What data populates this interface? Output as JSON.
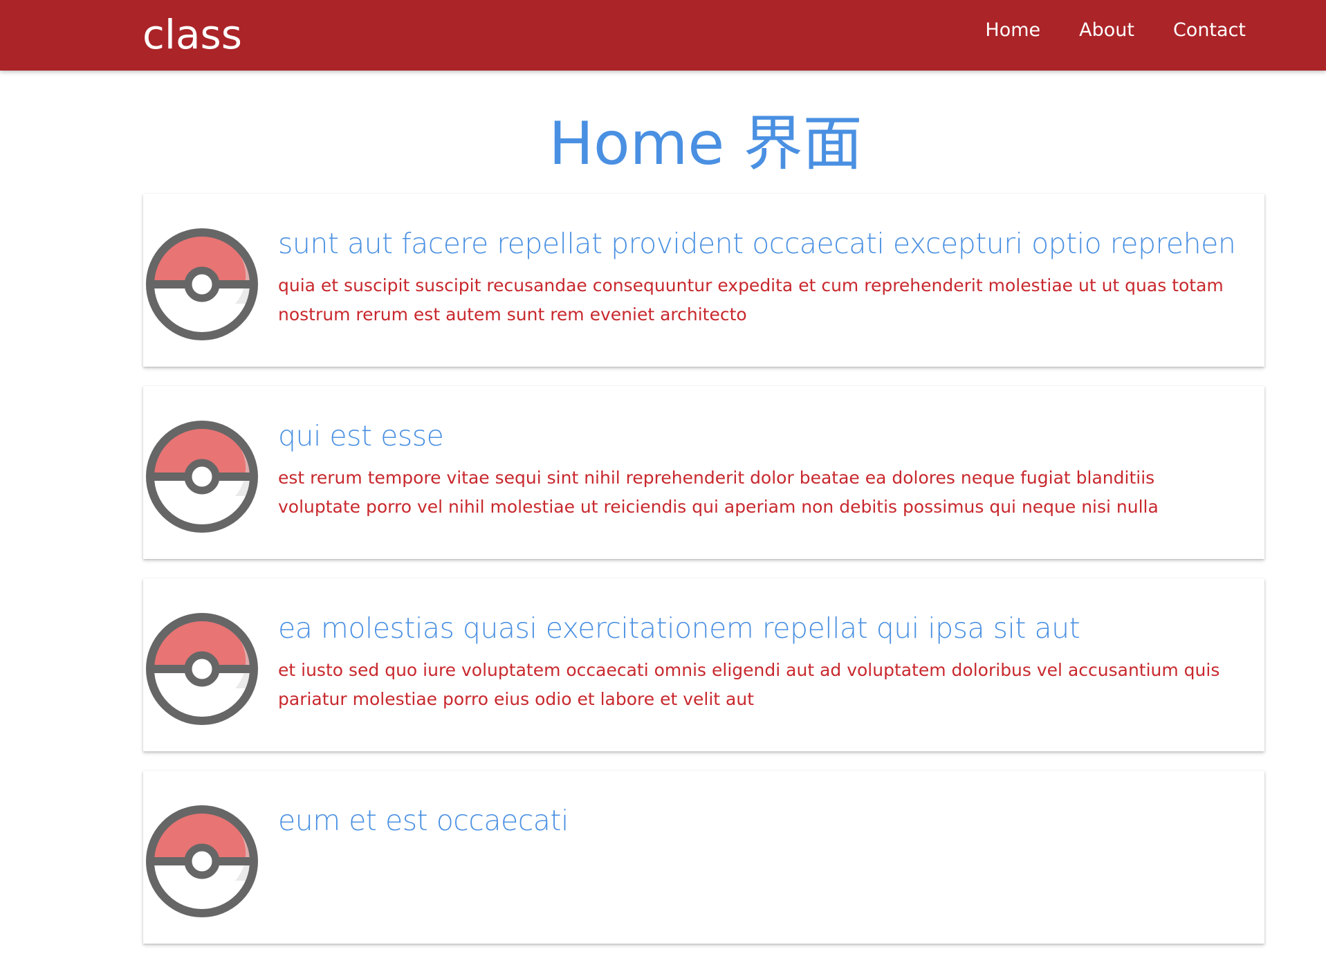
{
  "navbar": {
    "brand": "class",
    "links": [
      "Home",
      "About",
      "Contact"
    ],
    "background_color": "#ab2428"
  },
  "page": {
    "title": "Home 界面",
    "title_color": "#4a90e2"
  },
  "posts": [
    {
      "title": "sunt aut facere repellat provident occaecati excepturi optio reprehenderit",
      "body": "quia et suscipit suscipit recusandae consequuntur expedita et cum reprehenderit molestiae ut ut quas totam nostrum rerum est autem sunt rem eveniet architecto",
      "icon": "pokeball-icon"
    },
    {
      "title": "qui est esse",
      "body": "est rerum tempore vitae sequi sint nihil reprehenderit dolor beatae ea dolores neque fugiat blanditiis voluptate porro vel nihil molestiae ut reiciendis qui aperiam non debitis possimus qui neque nisi nulla",
      "icon": "pokeball-icon"
    },
    {
      "title": "ea molestias quasi exercitationem repellat qui ipsa sit aut",
      "body": "et iusto sed quo iure voluptatem occaecati omnis eligendi aut ad voluptatem doloribus vel accusantium quis pariatur molestiae porro eius odio et labore et velit aut",
      "icon": "pokeball-icon"
    },
    {
      "title": "eum et est occaecati",
      "body": "",
      "icon": "pokeball-icon"
    }
  ],
  "colors": {
    "post_title": "#4a90e2",
    "post_body": "#c8282d",
    "pokeball_red": "#e87474",
    "pokeball_outline": "#666666"
  }
}
